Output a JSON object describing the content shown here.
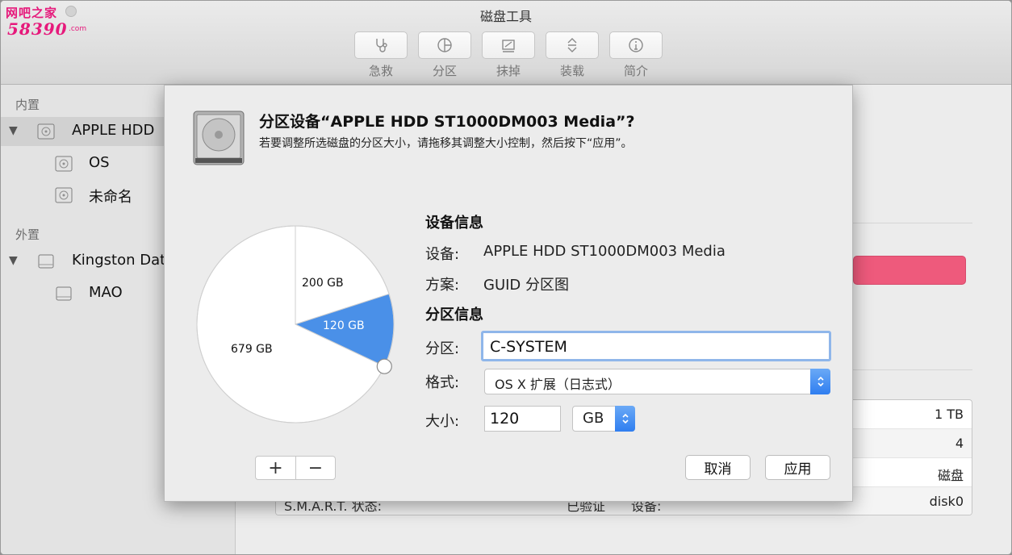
{
  "watermark": {
    "top": "网吧之家",
    "bottom": "58390",
    "suffix": ".com"
  },
  "app": {
    "title": "磁盘工具"
  },
  "toolbar": [
    {
      "label": "急救",
      "icon": "stethoscope-icon"
    },
    {
      "label": "分区",
      "icon": "partition-icon"
    },
    {
      "label": "抹掉",
      "icon": "erase-icon"
    },
    {
      "label": "装载",
      "icon": "mount-icon"
    },
    {
      "label": "简介",
      "icon": "info-icon"
    }
  ],
  "sidebar": {
    "internal_header": "内置",
    "external_header": "外置",
    "items": [
      {
        "label": "APPLE HDD",
        "level": 0,
        "selected": true
      },
      {
        "label": "OS",
        "level": 1
      },
      {
        "label": "未命名",
        "level": 1
      },
      {
        "label": "Kingston Dat",
        "level": 0
      },
      {
        "label": "MAO",
        "level": 1
      }
    ]
  },
  "background_info": {
    "rows": [
      "1 TB",
      "4",
      "磁盘",
      "disk0"
    ],
    "smart_label": "S.M.A.R.T. 状态:",
    "verified": "已验证",
    "device_label": "设备:",
    "usage_color": "#ee5a7c"
  },
  "dialog": {
    "title": "分区设备“APPLE HDD ST1000DM003 Media”?",
    "subtitle": "若要调整所选磁盘的分区大小，请拖移其调整大小控制，然后按下“应用”。",
    "pie": {
      "slices": [
        {
          "label": "200 GB",
          "gb": 200,
          "color": "#ffffff"
        },
        {
          "label": "120 GB",
          "gb": 120,
          "color": "#4a90e8"
        },
        {
          "label": "679 GB",
          "gb": 679,
          "color": "#ffffff"
        }
      ]
    },
    "device_info_heading": "设备信息",
    "device_label": "设备:",
    "device_value": "APPLE HDD ST1000DM003 Media",
    "scheme_label": "方案:",
    "scheme_value": "GUID 分区图",
    "partition_info_heading": "分区信息",
    "partition_label": "分区:",
    "partition_value": "C-SYSTEM",
    "format_label": "格式:",
    "format_value": "OS X 扩展（日志式）",
    "size_label": "大小:",
    "size_value": "120",
    "size_unit": "GB",
    "add_label": "+",
    "remove_label": "−",
    "cancel_label": "取消",
    "apply_label": "应用",
    "accent_color": "#4a90e8"
  }
}
